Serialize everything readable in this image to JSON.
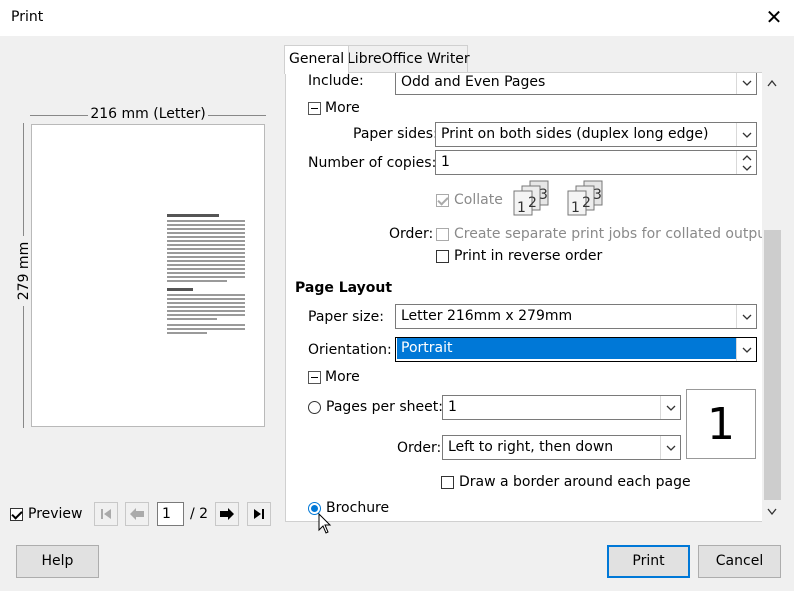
{
  "window": {
    "title": "Print",
    "close_glyph": "✕"
  },
  "preview": {
    "width_label": "216 mm (Letter)",
    "height_label": "279 mm",
    "checkbox_label": "Preview",
    "current_page": "1",
    "total_pages": "/ 2"
  },
  "tabs": [
    {
      "label": "General"
    },
    {
      "label": "LibreOffice Writer"
    }
  ],
  "general": {
    "include_label": "Include:",
    "include_value": "Odd and Even Pages",
    "more_label_1": "More",
    "paper_sides_label": "Paper sides:",
    "paper_sides_value": "Print on both sides (duplex long edge)",
    "copies_label": "Number of copies:",
    "copies_value": "1",
    "collate_label": "Collate",
    "order_label": "Order:",
    "separate_jobs_label": "Create separate print jobs for collated output",
    "reverse_order_label": "Print in reverse order",
    "page_layout_heading": "Page Layout",
    "paper_size_label": "Paper size:",
    "paper_size_value": "Letter 216mm x 279mm",
    "orientation_label": "Orientation:",
    "orientation_value": "Portrait",
    "more_label_2": "More",
    "pages_per_sheet_label": "Pages per sheet:",
    "pages_per_sheet_value": "1",
    "pps_preview_value": "1",
    "order2_label": "Order:",
    "order2_value": "Left to right, then down",
    "border_label": "Draw a border around each page",
    "brochure_label": "Brochure"
  },
  "buttons": {
    "help": "Help",
    "print": "Print",
    "cancel": "Cancel"
  }
}
